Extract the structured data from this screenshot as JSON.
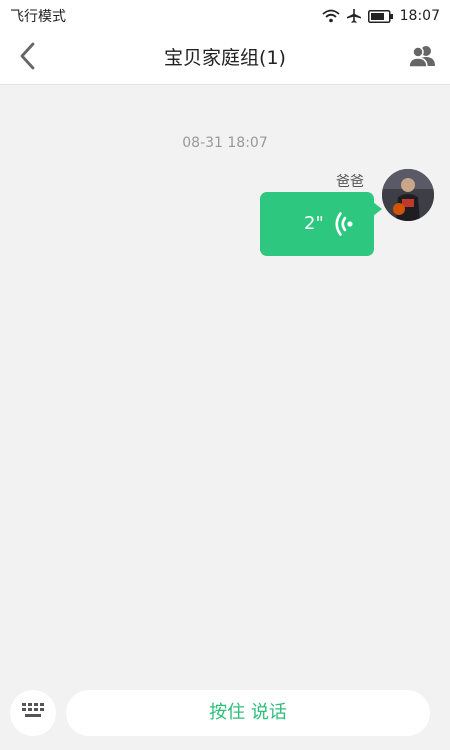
{
  "status_bar": {
    "mode_text": "飞行模式",
    "time": "18:07",
    "icons": [
      "wifi-icon",
      "airplane-icon",
      "battery-icon"
    ]
  },
  "nav": {
    "title": "宝贝家庭组(1)",
    "back_icon": "back-arrow-icon",
    "members_icon": "group-members-icon"
  },
  "chat": {
    "timestamp": "08-31 18:07",
    "messages": [
      {
        "sender": "爸爸",
        "type": "voice",
        "duration": "2\"",
        "bubble_color": "#2dc77f"
      }
    ]
  },
  "input_bar": {
    "keyboard_icon": "keyboard-icon",
    "talk_label": "按住 说话"
  },
  "colors": {
    "accent": "#2dc77f",
    "background": "#f2f2f2"
  }
}
